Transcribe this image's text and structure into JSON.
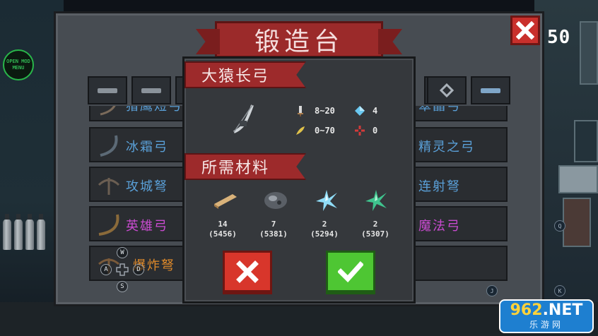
{
  "hud": {
    "mod_menu_label": "OPEN MOD MENU",
    "counter": "50"
  },
  "forge": {
    "title": "锻造台",
    "tabs": [
      "bow-tab",
      "rifle-tab",
      "crossbow-tab",
      "gun-tab",
      "diamond-tab",
      "shark-gun-tab"
    ],
    "list": [
      {
        "left": "猎鹰短弓",
        "right": "翠晶弓",
        "left_color": "#5aa0d8",
        "right_color": "#5aa0d8"
      },
      {
        "left": "冰霜弓",
        "right": "精灵之弓",
        "left_color": "#5aa0d8",
        "right_color": "#5aa0d8"
      },
      {
        "left": "攻城弩",
        "right": "连射弩",
        "left_color": "#5aa0d8",
        "right_color": "#5aa0d8"
      },
      {
        "left": "英雄弓",
        "right": "魔法弓",
        "left_color": "#c94bd0",
        "right_color": "#c94bd0"
      },
      {
        "left": "爆炸弩",
        "right": "",
        "left_color": "#e08a2a",
        "right_color": "#e08a2a"
      }
    ]
  },
  "detail": {
    "weapon_name": "大猿长弓",
    "damage": "8~20",
    "energy": "4",
    "crit": "0~70",
    "inaccuracy": "0",
    "materials_title": "所需材料",
    "materials": [
      {
        "name": "wood",
        "need": "14",
        "have": "(5456)"
      },
      {
        "name": "iron-ore",
        "need": "7",
        "have": "(5381)"
      },
      {
        "name": "blue-crystal",
        "need": "2",
        "have": "(5294)"
      },
      {
        "name": "green-crystal",
        "need": "2",
        "have": "(5307)"
      }
    ]
  },
  "controls": {
    "dpad": {
      "up": "W",
      "left": "A",
      "right": "D",
      "down": "S"
    },
    "hint_j": "J",
    "hint_k": "K",
    "hint_q": "Q"
  },
  "watermark": {
    "main_digits": "962",
    "main_suffix": ".NET",
    "sub": "乐游网"
  },
  "colors": {
    "ribbon_red": "#9d2a2b",
    "cancel_red": "#d8362b",
    "confirm_green": "#4ec633",
    "panel_gray": "#474c52"
  }
}
